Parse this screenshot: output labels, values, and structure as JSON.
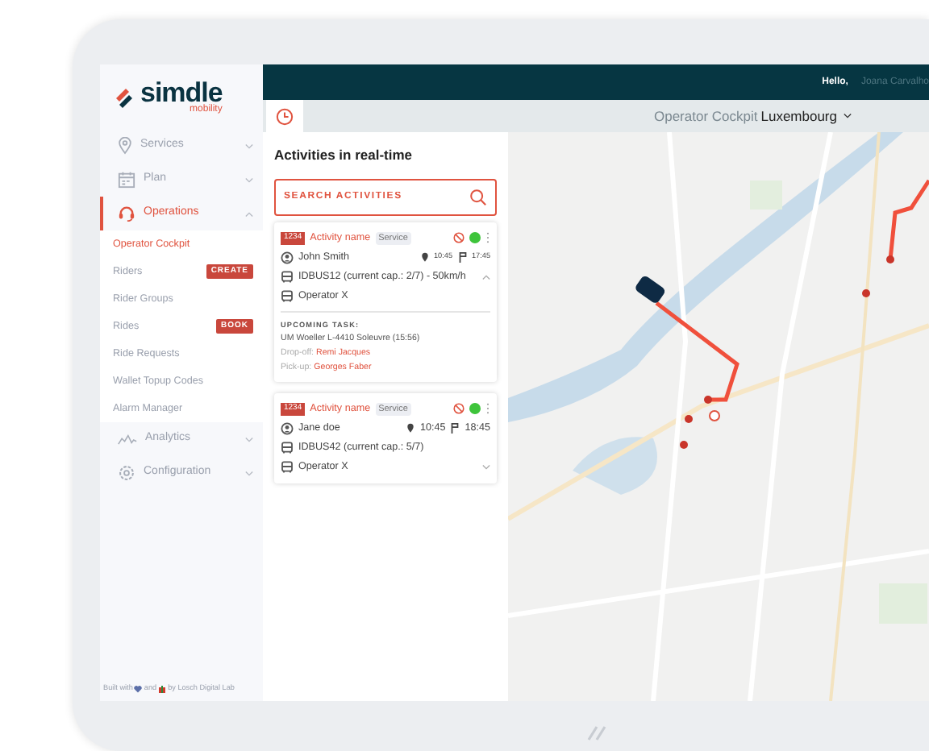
{
  "brand": {
    "name": "simdle",
    "tagline": "mobility"
  },
  "sidebar": {
    "items": [
      {
        "label": "Services",
        "selected": false,
        "expanded": false
      },
      {
        "label": "Plan",
        "selected": false,
        "expanded": false
      },
      {
        "label": "Operations",
        "selected": true,
        "expanded": true,
        "children": [
          {
            "label": "Operator Cockpit",
            "selected": true
          },
          {
            "label": "Riders",
            "selected": false,
            "badge": "CREATE"
          },
          {
            "label": "Rider Groups",
            "selected": false
          },
          {
            "label": "Rides",
            "selected": false,
            "badge": "BOOK"
          },
          {
            "label": "Ride Requests",
            "selected": false
          },
          {
            "label": "Wallet Topup Codes",
            "selected": false
          },
          {
            "label": "Alarm Manager",
            "selected": false
          }
        ]
      },
      {
        "label": "Analytics",
        "selected": false,
        "expanded": false
      },
      {
        "label": "Configuration",
        "selected": false,
        "expanded": false
      }
    ],
    "footer": [
      "Built with",
      "and",
      "by Losch Digital Lab"
    ]
  },
  "header": {
    "greeting": "Hello,",
    "user": "Joana Carvalho"
  },
  "cockpit": {
    "title": "Operator Cockpit",
    "region": "Luxembourg"
  },
  "panel": {
    "title": "Activities in real-time",
    "search": {
      "placeholder": "SEARCH ACTIVITIES"
    },
    "activities": [
      {
        "id": "1234",
        "name": "Activity name",
        "tag": "Service",
        "color": "#3ec43b",
        "rider": "John Smith",
        "start_time": "10:45",
        "end_time": "17:45",
        "vehicle": "IDBUS12 (current cap.: 2/7) - 50km/h",
        "operator": "Operator X",
        "expanded": true,
        "upcoming": {
          "label": "UPCOMING TASK:",
          "address": "UM Woeller L-4410 Soleuvre (15:56)",
          "dropoff_label": "Drop-off:",
          "dropoff": "Remi Jacques",
          "pickup_label": "Pick-up:",
          "pickup": "Georges Faber"
        }
      },
      {
        "id": "1234",
        "name": "Activity name",
        "tag": "Service",
        "color": "#3ec43b",
        "rider": "Jane doe",
        "start_time": "10:45",
        "end_time": "18:45",
        "vehicle": "IDBUS42 (current cap.: 5/7)",
        "operator": "Operator X",
        "expanded": false
      }
    ]
  }
}
